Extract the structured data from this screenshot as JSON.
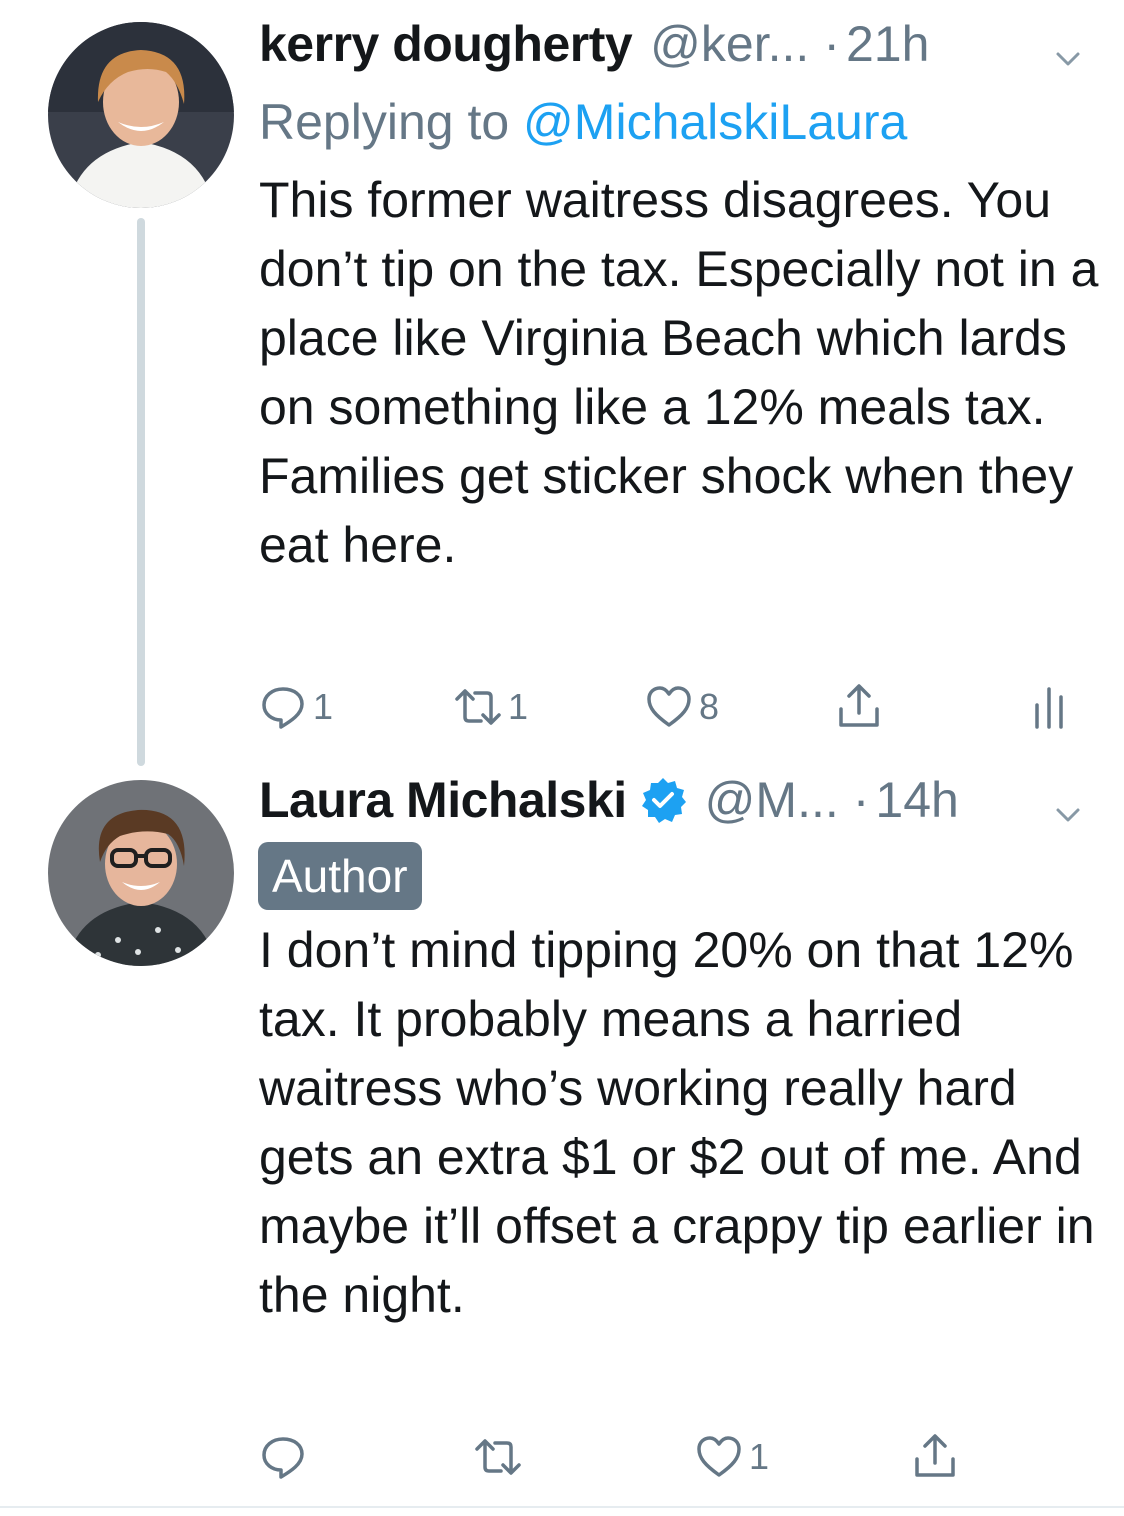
{
  "tweets": [
    {
      "name": "kerry dougherty",
      "handle": "@ker...",
      "separator": "·",
      "time": "21h",
      "replying_prefix": "Replying to ",
      "replying_mention": "@MichalskiLaura",
      "text": "This former waitress disagrees. You don’t tip on the tax. Especially not in a place like Virginia Beach which lards on something like a 12% meals tax. Families get sticker shock when they eat here.",
      "actions": {
        "reply_count": "1",
        "retweet_count": "1",
        "like_count": "8"
      },
      "icons": [
        "reply-icon",
        "retweet-icon",
        "like-icon",
        "share-icon",
        "analytics-icon",
        "chevron-down-icon"
      ]
    },
    {
      "name": "Laura Michalski",
      "verified": true,
      "handle": "@M...",
      "separator": "·",
      "time": "14h",
      "badge": "Author",
      "text": "I don’t mind tipping 20% on that 12% tax. It probably means a harried waitress who’s working really hard gets an extra $1 or $2 out of me. And maybe it’ll offset a crappy tip earlier in the night.",
      "actions": {
        "like_count": "1"
      },
      "icons": [
        "reply-icon",
        "retweet-icon",
        "like-icon",
        "share-icon",
        "verified-badge-icon",
        "chevron-down-icon"
      ]
    }
  ],
  "colors": {
    "text_primary": "#14171a",
    "text_secondary": "#657786",
    "link_blue": "#1da1f2",
    "thread_line": "#cfd9de",
    "badge_bg": "#657786"
  }
}
